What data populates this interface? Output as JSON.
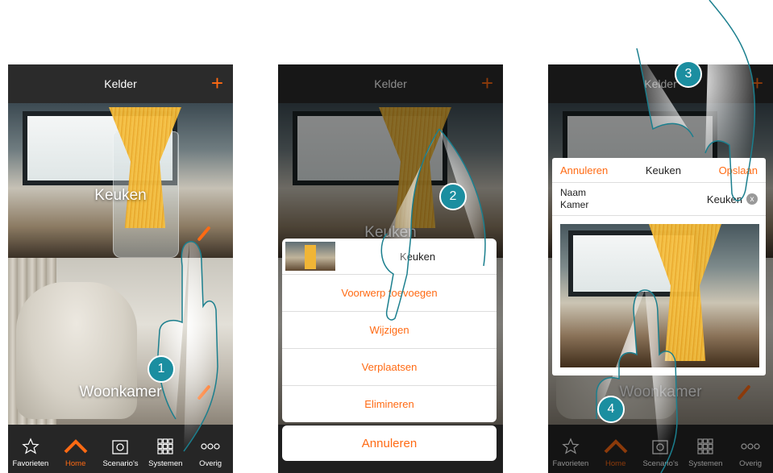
{
  "colors": {
    "accent": "#ff6a13",
    "marker": "#1b8ea0",
    "topbar": "#2b2b2b",
    "tabbar": "#262626"
  },
  "screen1": {
    "title": "Kelder",
    "add_icon": "plus-icon",
    "rooms": [
      {
        "label": "Keuken"
      },
      {
        "label": "Woonkamer"
      }
    ],
    "tabs": [
      {
        "label": "Favorieten",
        "icon": "star-icon"
      },
      {
        "label": "Home",
        "icon": "home-icon"
      },
      {
        "label": "Scenario's",
        "icon": "scenario-icon"
      },
      {
        "label": "Systemen",
        "icon": "grid-icon"
      },
      {
        "label": "Overig",
        "icon": "more-icon"
      }
    ],
    "step": "1"
  },
  "screen2": {
    "title": "Kelder",
    "room_label": "Keuken",
    "sheet_title": "Keuken",
    "actions": [
      "Voorwerp toevoegen",
      "Wijzigen",
      "Verplaatsen",
      "Elimineren"
    ],
    "cancel": "Annuleren",
    "step": "2"
  },
  "screen3": {
    "title": "Kelder",
    "dialog": {
      "cancel": "Annuleren",
      "title": "Keuken",
      "save": "Opslaan",
      "name_label": "Naam Kamer",
      "name_value": "Keuken",
      "clear": "x"
    },
    "room_label": "Woonkamer",
    "tabs": [
      "Favorieten",
      "Home",
      "Scenario's",
      "Systemen",
      "Overig"
    ],
    "steps": [
      "3",
      "4"
    ]
  }
}
